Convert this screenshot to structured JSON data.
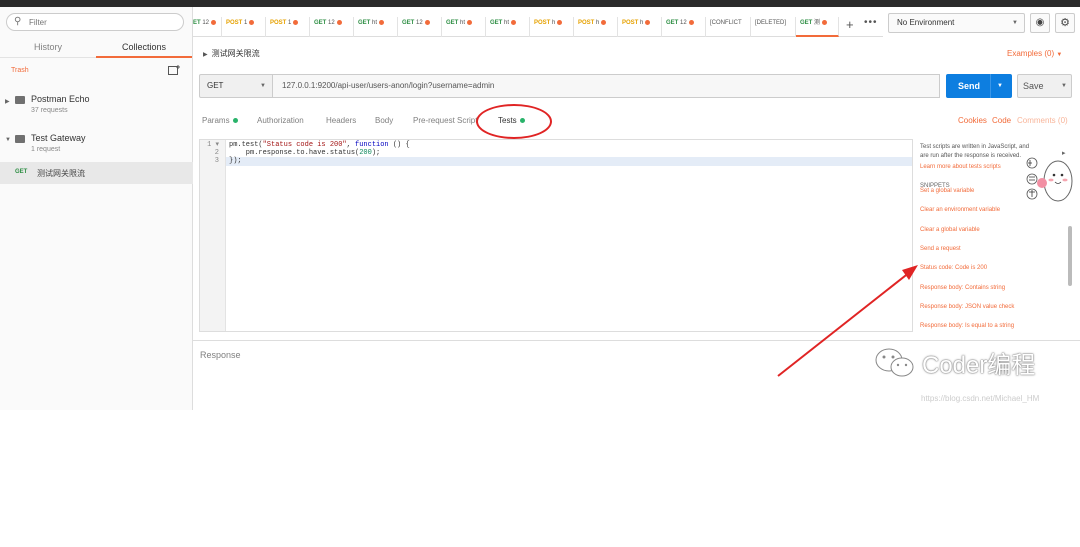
{
  "sidebar": {
    "filter_placeholder": "Filter",
    "tabs": [
      "History",
      "Collections"
    ],
    "trash": "Trash",
    "collections": [
      {
        "name": "Postman Echo",
        "count": "37 requests"
      },
      {
        "name": "Test Gateway",
        "count": "1 request"
      }
    ],
    "request": {
      "method": "GET",
      "name": "测试网关限流"
    }
  },
  "request_tabs": [
    {
      "method": "ET",
      "name": "12"
    },
    {
      "method": "POST",
      "name": "1"
    },
    {
      "method": "POST",
      "name": "1"
    },
    {
      "method": "GET",
      "name": "12"
    },
    {
      "method": "GET",
      "name": "ht"
    },
    {
      "method": "GET",
      "name": "12"
    },
    {
      "method": "GET",
      "name": "ht"
    },
    {
      "method": "GET",
      "name": "ht"
    },
    {
      "method": "POST",
      "name": "h"
    },
    {
      "method": "POST",
      "name": "h"
    },
    {
      "method": "POST",
      "name": "h"
    },
    {
      "method": "GET",
      "name": "12"
    },
    {
      "method": "",
      "name": "[CONFLICT"
    },
    {
      "method": "",
      "name": "[DELETED]"
    },
    {
      "method": "GET",
      "name": "测"
    }
  ],
  "environment": "No Environment",
  "request_title": "测试网关限流",
  "examples": "Examples (0)",
  "method": "GET",
  "url": "127.0.0.1:9200/api-user/users-anon/login?username=admin",
  "send": "Send",
  "save": "Save",
  "tabs": [
    "Params",
    "Authorization",
    "Headers",
    "Body",
    "Pre-request Script",
    "Tests"
  ],
  "right_links": {
    "cookies": "Cookies",
    "code": "Code",
    "comments": "Comments (0)"
  },
  "code_lines": [
    {
      "n": "1",
      "text": "pm.test(\"Status code is 200\", function () {"
    },
    {
      "n": "2",
      "text": "    pm.response.to.have.status(200);"
    },
    {
      "n": "3",
      "text": "});"
    }
  ],
  "tests_help": {
    "text": "Test scripts are written in JavaScript, and are run after the response is received.",
    "learn": "Learn more about tests scripts",
    "snippets_title": "SNIPPETS",
    "snippets": [
      "Set a global variable",
      "Clear an environment variable",
      "Clear a global variable",
      "Send a request",
      "Status code: Code is 200",
      "Response body: Contains string",
      "Response body: JSON value check",
      "Response body: Is equal to a string"
    ]
  },
  "response_label": "Response",
  "watermark": {
    "title": "Coder编程",
    "url": "https://blog.csdn.net/Michael_HM"
  },
  "colors": {
    "accent": "#f26b3a",
    "send": "#0d7ee0",
    "tests_dot": "#29b36a",
    "annotation": "#e02424"
  }
}
